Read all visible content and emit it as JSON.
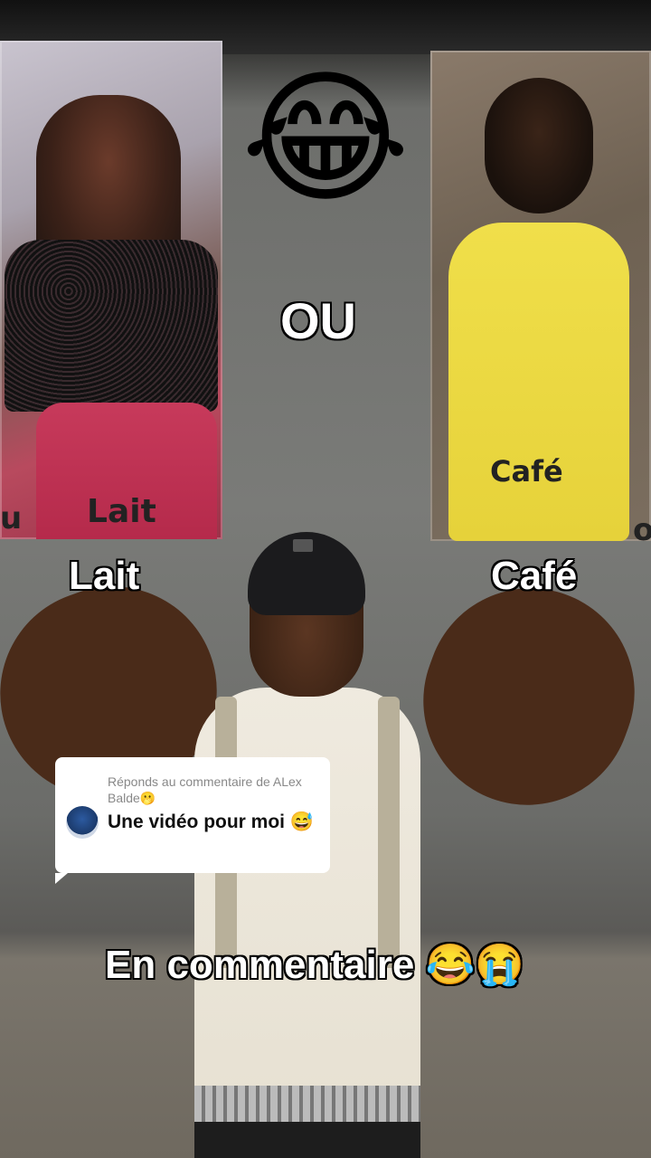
{
  "top_emoji": "😂",
  "center_text": "OU",
  "left_photo": {
    "caption": "Lait",
    "edge_letter": "u"
  },
  "right_photo": {
    "caption": "Café",
    "edge_letter": "o"
  },
  "labels": {
    "left": "Lait",
    "right": "Café"
  },
  "reply": {
    "header": "Réponds au commentaire de ALex  Balde🫢",
    "text": "Une vidéo pour moi 😅"
  },
  "bottom_caption": "En commentaire 😂😭"
}
